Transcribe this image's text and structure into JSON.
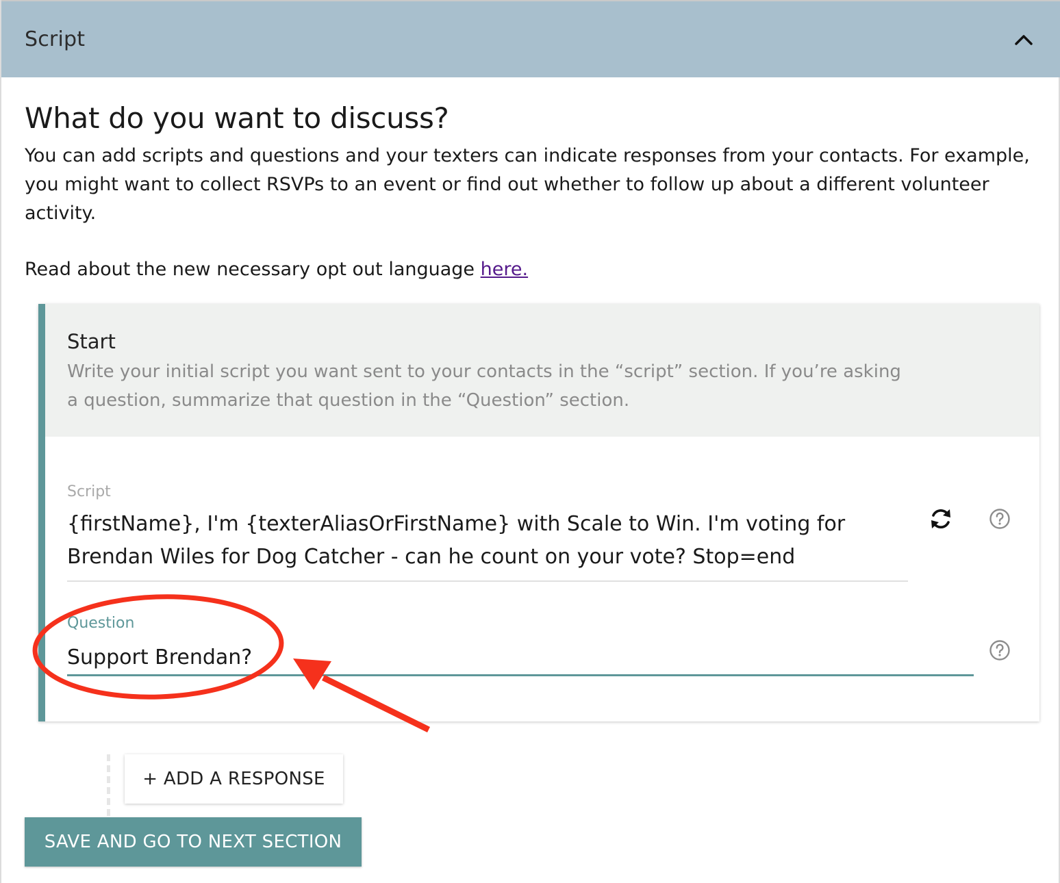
{
  "section": {
    "title": "Script"
  },
  "intro": {
    "heading": "What do you want to discuss?",
    "description": "You can add scripts and questions and your texters can indicate responses from your contacts. For example, you might want to collect RSVPs to an event or find out whether to follow up about a different volunteer activity.",
    "optout_prefix": "Read about the new necessary opt out language ",
    "optout_link": "here."
  },
  "card": {
    "title": "Start",
    "subtitle": "Write your initial script you want sent to your contacts in the “script” section. If you’re asking a question, summarize that question in the “Question” section.",
    "script_label": "Script",
    "script_value": "{firstName}, I'm {texterAliasOrFirstName} with Scale to Win. I'm voting for Brendan Wiles for Dog Catcher - can he count on your vote? Stop=end",
    "question_label": "Question",
    "question_value": "Support Brendan?"
  },
  "buttons": {
    "add_response": "+ ADD A RESPONSE",
    "save_next": "SAVE AND GO TO NEXT SECTION"
  },
  "icons": {
    "collapse": "chevron-up-icon",
    "refresh": "refresh-icon",
    "help": "help-circle-icon"
  },
  "colors": {
    "header_bg": "#a8bfcd",
    "accent": "#5e9799",
    "link": "#551a8b",
    "annotation": "#f5311c"
  }
}
